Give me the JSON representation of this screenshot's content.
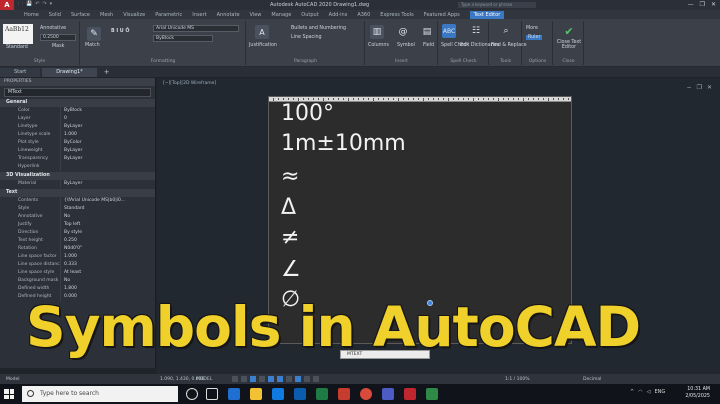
{
  "titlebar": {
    "logo": "A",
    "title": "Autodesk AutoCAD 2020   Drawing1.dwg",
    "search_placeholder": "Type a keyword or phrase",
    "qat": [
      "🗀",
      "💾",
      "↶",
      "↷",
      "▾"
    ],
    "controls": [
      "—",
      "❐",
      "✕"
    ]
  },
  "ribbon_tabs": [
    "Home",
    "Solid",
    "Surface",
    "Mesh",
    "Visualize",
    "Parametric",
    "Insert",
    "Annotate",
    "View",
    "Manage",
    "Output",
    "Add-ins",
    "A360",
    "Express Tools",
    "Featured Apps",
    "Text Editor"
  ],
  "active_tab": "Text Editor",
  "ribbon": {
    "style_preview": "AaBb12",
    "style_name": "Standard",
    "style_group": "Style",
    "annotative": "Annotative",
    "text_height": "0.2500",
    "mask": "Mask",
    "match": "Match",
    "font": "Arial Unicode MS",
    "color": "ByBlock",
    "formatting_group": "Formatting",
    "justification": "Justification",
    "bullets": "Bullets and Numbering",
    "line_spacing": "Line Spacing",
    "paragraph_group": "Paragraph",
    "columns": "Columns",
    "symbol": "Symbol",
    "field": "Field",
    "insert_group": "Insert",
    "spell_check": "Spell Check",
    "edit_dictionaries": "Edit Dictionaries",
    "spell_group": "Spell Check",
    "find_replace": "Find & Replace",
    "tools_group": "Tools",
    "more": "More",
    "ruler": "Ruler",
    "options_group": "Options",
    "close_editor": "Close Text Editor",
    "close_group": "Close"
  },
  "doc_tabs": [
    "Start",
    "Drawing1*"
  ],
  "properties": {
    "header": "PROPERTIES",
    "selection": "MText",
    "sections": [
      {
        "title": "General",
        "rows": [
          [
            "Color",
            "ByBlock"
          ],
          [
            "Layer",
            "0"
          ],
          [
            "Linetype",
            "ByLayer"
          ],
          [
            "Linetype scale",
            "1.000"
          ],
          [
            "Plot style",
            "ByColor"
          ],
          [
            "Lineweight",
            "ByLayer"
          ],
          [
            "Transparency",
            "ByLayer"
          ],
          [
            "Hyperlink",
            ""
          ]
        ]
      },
      {
        "title": "3D Visualization",
        "rows": [
          [
            "Material",
            "ByLayer"
          ]
        ]
      },
      {
        "title": "Text",
        "rows": [
          [
            "Contents",
            "{\\fArial Unicode MS|b0|i0..."
          ],
          [
            "Style",
            "Standard"
          ],
          [
            "Annotative",
            "No"
          ],
          [
            "Justify",
            "Top left"
          ],
          [
            "Direction",
            "By style"
          ],
          [
            "Text height",
            "0.250"
          ],
          [
            "Rotation",
            "N0d0'0\""
          ],
          [
            "Line space factor",
            "1.000"
          ],
          [
            "Line space distance",
            "0.333"
          ],
          [
            "Line space style",
            "At least"
          ],
          [
            "Background mask",
            "No"
          ],
          [
            "Defined width",
            "1.800"
          ],
          [
            "Defined height",
            "0.000"
          ]
        ]
      }
    ]
  },
  "drawing": {
    "view_label": "[−][Top][2D Wireframe]",
    "nav_icons": [
      "−",
      "❐",
      "✕"
    ],
    "symbols": [
      "100°",
      "1m±10mm",
      "≈",
      "Δ",
      "≠",
      "∠",
      "∅"
    ]
  },
  "headline": "Symbols in AutoCAD",
  "command_line": "MTEXT",
  "statusbar": {
    "model": "Model",
    "coords": "1.090, 1.430, 0.000",
    "model_btn": "MODEL",
    "scale": "1:1 / 100%",
    "units": "Decimal"
  },
  "taskbar": {
    "search_placeholder": "Type here to search",
    "time": "10:31 AM",
    "date": "2/05/2025",
    "lang": "ENG"
  },
  "colors": {
    "headline": "#f0d02a",
    "accent": "#3b78c4",
    "drawing_bg": "#212830",
    "editor_bg": "#2c2c2c"
  }
}
